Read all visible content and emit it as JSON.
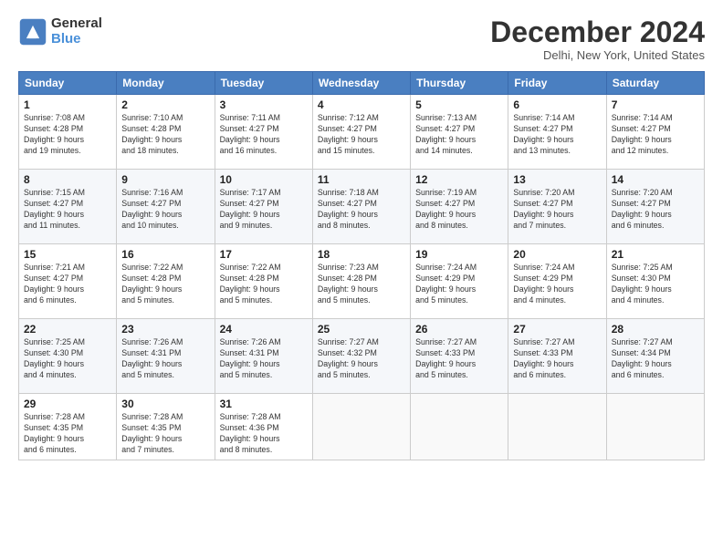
{
  "logo": {
    "general": "General",
    "blue": "Blue"
  },
  "title": "December 2024",
  "location": "Delhi, New York, United States",
  "days_of_week": [
    "Sunday",
    "Monday",
    "Tuesday",
    "Wednesday",
    "Thursday",
    "Friday",
    "Saturday"
  ],
  "weeks": [
    [
      {
        "day": "1",
        "sunrise": "7:08 AM",
        "sunset": "4:28 PM",
        "daylight": "9 hours and 19 minutes."
      },
      {
        "day": "2",
        "sunrise": "7:10 AM",
        "sunset": "4:28 PM",
        "daylight": "9 hours and 18 minutes."
      },
      {
        "day": "3",
        "sunrise": "7:11 AM",
        "sunset": "4:27 PM",
        "daylight": "9 hours and 16 minutes."
      },
      {
        "day": "4",
        "sunrise": "7:12 AM",
        "sunset": "4:27 PM",
        "daylight": "9 hours and 15 minutes."
      },
      {
        "day": "5",
        "sunrise": "7:13 AM",
        "sunset": "4:27 PM",
        "daylight": "9 hours and 14 minutes."
      },
      {
        "day": "6",
        "sunrise": "7:14 AM",
        "sunset": "4:27 PM",
        "daylight": "9 hours and 13 minutes."
      },
      {
        "day": "7",
        "sunrise": "7:14 AM",
        "sunset": "4:27 PM",
        "daylight": "9 hours and 12 minutes."
      }
    ],
    [
      {
        "day": "8",
        "sunrise": "7:15 AM",
        "sunset": "4:27 PM",
        "daylight": "9 hours and 11 minutes."
      },
      {
        "day": "9",
        "sunrise": "7:16 AM",
        "sunset": "4:27 PM",
        "daylight": "9 hours and 10 minutes."
      },
      {
        "day": "10",
        "sunrise": "7:17 AM",
        "sunset": "4:27 PM",
        "daylight": "9 hours and 9 minutes."
      },
      {
        "day": "11",
        "sunrise": "7:18 AM",
        "sunset": "4:27 PM",
        "daylight": "9 hours and 8 minutes."
      },
      {
        "day": "12",
        "sunrise": "7:19 AM",
        "sunset": "4:27 PM",
        "daylight": "9 hours and 8 minutes."
      },
      {
        "day": "13",
        "sunrise": "7:20 AM",
        "sunset": "4:27 PM",
        "daylight": "9 hours and 7 minutes."
      },
      {
        "day": "14",
        "sunrise": "7:20 AM",
        "sunset": "4:27 PM",
        "daylight": "9 hours and 6 minutes."
      }
    ],
    [
      {
        "day": "15",
        "sunrise": "7:21 AM",
        "sunset": "4:27 PM",
        "daylight": "9 hours and 6 minutes."
      },
      {
        "day": "16",
        "sunrise": "7:22 AM",
        "sunset": "4:28 PM",
        "daylight": "9 hours and 5 minutes."
      },
      {
        "day": "17",
        "sunrise": "7:22 AM",
        "sunset": "4:28 PM",
        "daylight": "9 hours and 5 minutes."
      },
      {
        "day": "18",
        "sunrise": "7:23 AM",
        "sunset": "4:28 PM",
        "daylight": "9 hours and 5 minutes."
      },
      {
        "day": "19",
        "sunrise": "7:24 AM",
        "sunset": "4:29 PM",
        "daylight": "9 hours and 5 minutes."
      },
      {
        "day": "20",
        "sunrise": "7:24 AM",
        "sunset": "4:29 PM",
        "daylight": "9 hours and 4 minutes."
      },
      {
        "day": "21",
        "sunrise": "7:25 AM",
        "sunset": "4:30 PM",
        "daylight": "9 hours and 4 minutes."
      }
    ],
    [
      {
        "day": "22",
        "sunrise": "7:25 AM",
        "sunset": "4:30 PM",
        "daylight": "9 hours and 4 minutes."
      },
      {
        "day": "23",
        "sunrise": "7:26 AM",
        "sunset": "4:31 PM",
        "daylight": "9 hours and 5 minutes."
      },
      {
        "day": "24",
        "sunrise": "7:26 AM",
        "sunset": "4:31 PM",
        "daylight": "9 hours and 5 minutes."
      },
      {
        "day": "25",
        "sunrise": "7:27 AM",
        "sunset": "4:32 PM",
        "daylight": "9 hours and 5 minutes."
      },
      {
        "day": "26",
        "sunrise": "7:27 AM",
        "sunset": "4:33 PM",
        "daylight": "9 hours and 5 minutes."
      },
      {
        "day": "27",
        "sunrise": "7:27 AM",
        "sunset": "4:33 PM",
        "daylight": "9 hours and 6 minutes."
      },
      {
        "day": "28",
        "sunrise": "7:27 AM",
        "sunset": "4:34 PM",
        "daylight": "9 hours and 6 minutes."
      }
    ],
    [
      {
        "day": "29",
        "sunrise": "7:28 AM",
        "sunset": "4:35 PM",
        "daylight": "9 hours and 6 minutes."
      },
      {
        "day": "30",
        "sunrise": "7:28 AM",
        "sunset": "4:35 PM",
        "daylight": "9 hours and 7 minutes."
      },
      {
        "day": "31",
        "sunrise": "7:28 AM",
        "sunset": "4:36 PM",
        "daylight": "9 hours and 8 minutes."
      },
      null,
      null,
      null,
      null
    ]
  ],
  "labels": {
    "sunrise": "Sunrise:",
    "sunset": "Sunset:",
    "daylight": "Daylight:"
  }
}
